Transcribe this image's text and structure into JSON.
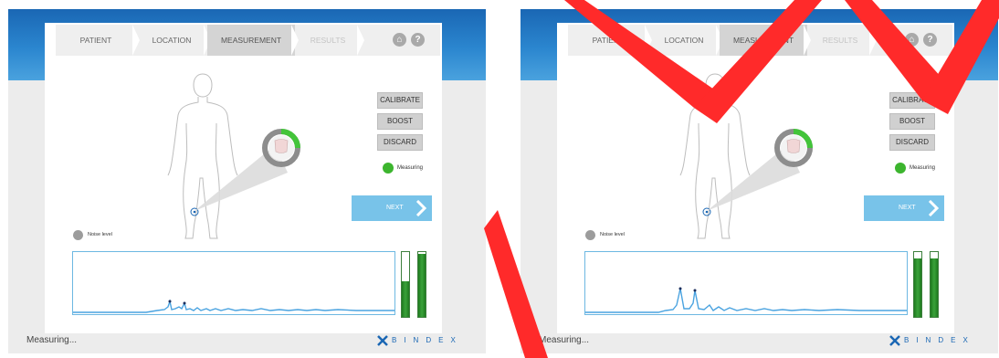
{
  "panels": [
    {
      "nav": {
        "steps": [
          "PATIENT",
          "LOCATION",
          "MEASUREMENT",
          "RESULTS"
        ],
        "active_step": "MEASUREMENT",
        "disabled_step": "RESULTS"
      },
      "buttons": {
        "calibrate": "CALIBRATE",
        "boost": "BOOST",
        "discard": "DISCARD",
        "next": "NEXT"
      },
      "status_indicator": "Measuring",
      "noise_label": "Noise level",
      "progress_fraction": 0.25,
      "meters": [
        0.55,
        0.97
      ],
      "statusbar_text": "Measuring...",
      "brand": "BINDEX"
    },
    {
      "nav": {
        "steps": [
          "PATIENT",
          "LOCATION",
          "MEASUREMENT",
          "RESULTS"
        ],
        "active_step": "MEASUREMENT",
        "disabled_step": "RESULTS"
      },
      "buttons": {
        "calibrate": "CALIBRATE",
        "boost": "BOOST",
        "discard": "DISCARD",
        "next": "NEXT"
      },
      "status_indicator": "Measuring",
      "noise_label": "Noise level",
      "progress_fraction": 0.25,
      "meters": [
        0.9,
        0.9
      ],
      "statusbar_text": "Measuring...",
      "brand": "BINDEX"
    }
  ],
  "icons": {
    "home": "home-icon",
    "help": "help-icon",
    "next_arrow": "chevron-right-icon",
    "logo": "bindex-logo-icon"
  },
  "colors": {
    "accent_blue": "#1a67b4",
    "next_button": "#78c3e9",
    "status_green": "#3cb52e",
    "meter_green": "#2e8b2e",
    "signal": "#4aa3e0"
  }
}
